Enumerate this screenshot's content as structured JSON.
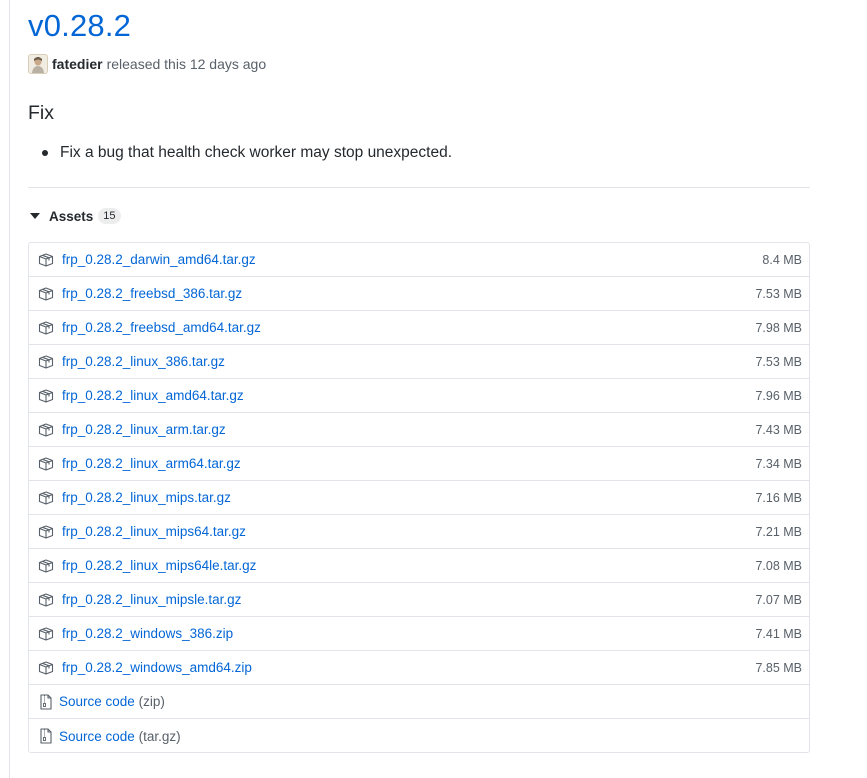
{
  "release": {
    "version": "v0.28.2",
    "author": "fatedier",
    "released_text": "released this 12 days ago",
    "notes_heading": "Fix",
    "notes": [
      "Fix a bug that health check worker may stop unexpected."
    ]
  },
  "assets": {
    "label": "Assets",
    "count": "15",
    "files": [
      {
        "name": "frp_0.28.2_darwin_amd64.tar.gz",
        "size": "8.4 MB",
        "icon": "package-icon"
      },
      {
        "name": "frp_0.28.2_freebsd_386.tar.gz",
        "size": "7.53 MB",
        "icon": "package-icon"
      },
      {
        "name": "frp_0.28.2_freebsd_amd64.tar.gz",
        "size": "7.98 MB",
        "icon": "package-icon"
      },
      {
        "name": "frp_0.28.2_linux_386.tar.gz",
        "size": "7.53 MB",
        "icon": "package-icon"
      },
      {
        "name": "frp_0.28.2_linux_amd64.tar.gz",
        "size": "7.96 MB",
        "icon": "package-icon"
      },
      {
        "name": "frp_0.28.2_linux_arm.tar.gz",
        "size": "7.43 MB",
        "icon": "package-icon"
      },
      {
        "name": "frp_0.28.2_linux_arm64.tar.gz",
        "size": "7.34 MB",
        "icon": "package-icon"
      },
      {
        "name": "frp_0.28.2_linux_mips.tar.gz",
        "size": "7.16 MB",
        "icon": "package-icon"
      },
      {
        "name": "frp_0.28.2_linux_mips64.tar.gz",
        "size": "7.21 MB",
        "icon": "package-icon"
      },
      {
        "name": "frp_0.28.2_linux_mips64le.tar.gz",
        "size": "7.08 MB",
        "icon": "package-icon"
      },
      {
        "name": "frp_0.28.2_linux_mipsle.tar.gz",
        "size": "7.07 MB",
        "icon": "package-icon"
      },
      {
        "name": "frp_0.28.2_windows_386.zip",
        "size": "7.41 MB",
        "icon": "package-icon"
      },
      {
        "name": "frp_0.28.2_windows_amd64.zip",
        "size": "7.85 MB",
        "icon": "package-icon"
      }
    ],
    "source": [
      {
        "label": "Source code",
        "format": "(zip)",
        "icon": "file-zip-icon"
      },
      {
        "label": "Source code",
        "format": "(tar.gz)",
        "icon": "file-zip-icon"
      }
    ]
  },
  "colors": {
    "link": "#0366d6",
    "text": "#24292e",
    "muted": "#586069",
    "border": "#e1e4e8"
  }
}
